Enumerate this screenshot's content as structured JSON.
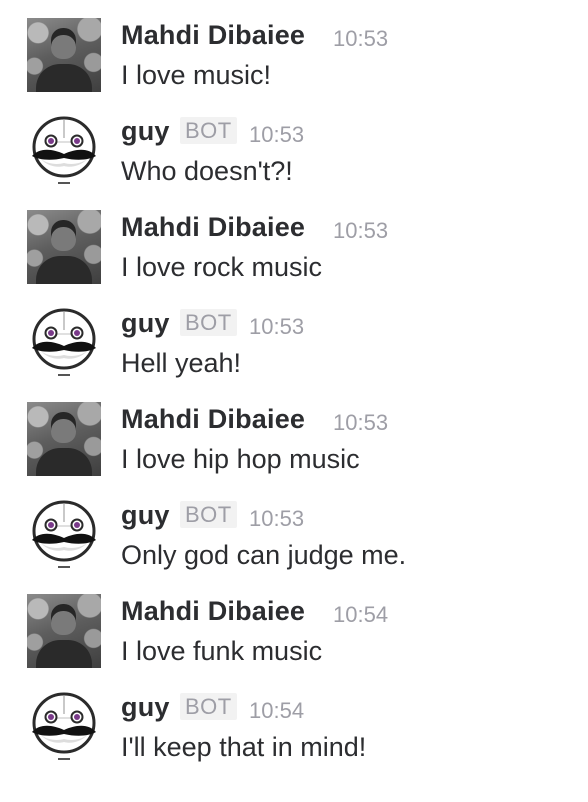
{
  "messages": [
    {
      "sender": "Mahdi Dibaiee",
      "bot": false,
      "time": "10:53",
      "text": "I love music!"
    },
    {
      "sender": "guy",
      "bot": true,
      "badge": "BOT",
      "time": "10:53",
      "text": "Who doesn't?!"
    },
    {
      "sender": "Mahdi Dibaiee",
      "bot": false,
      "time": "10:53",
      "text": "I love rock music"
    },
    {
      "sender": "guy",
      "bot": true,
      "badge": "BOT",
      "time": "10:53",
      "text": "Hell yeah!"
    },
    {
      "sender": "Mahdi Dibaiee",
      "bot": false,
      "time": "10:53",
      "text": "I love hip hop music"
    },
    {
      "sender": "guy",
      "bot": true,
      "badge": "BOT",
      "time": "10:53",
      "text": "Only god can judge me."
    },
    {
      "sender": "Mahdi Dibaiee",
      "bot": false,
      "time": "10:54",
      "text": "I love funk music"
    },
    {
      "sender": "guy",
      "bot": true,
      "badge": "BOT",
      "time": "10:54",
      "text": "I'll keep that in mind!"
    }
  ],
  "icons": {
    "user_avatar": "user-avatar-photo",
    "bot_avatar": "mustache-robot-avatar"
  }
}
